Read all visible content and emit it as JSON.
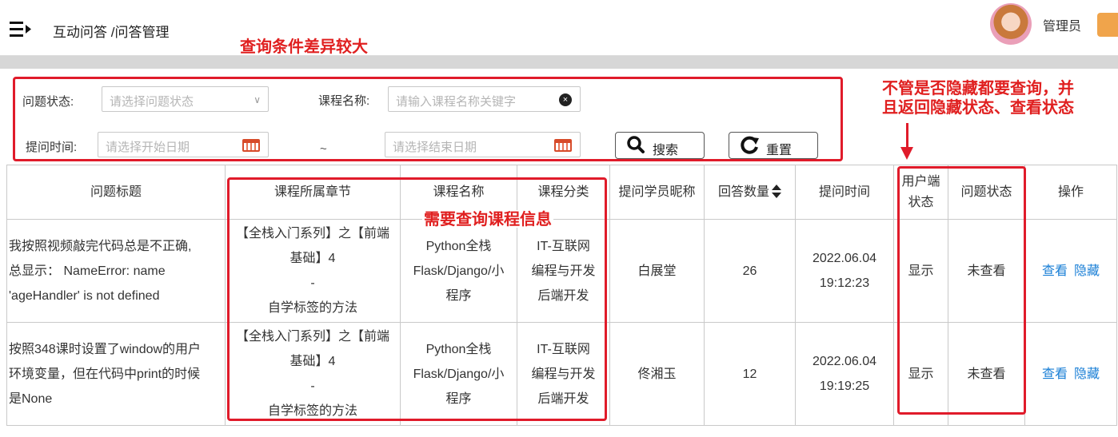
{
  "header": {
    "breadcrumb": "互动问答 /问答管理",
    "user_name": "管理员",
    "menu_icon": "menu-collapse-icon",
    "logout_icon": "logout-icon"
  },
  "annotations": {
    "filter_note": "查询条件差异较大",
    "course_note": "需要查询课程信息",
    "status_note_line1": "不管是否隐藏都要查询，并",
    "status_note_line2": "且返回隐藏状态、查看状态",
    "color": "#e01b2a"
  },
  "filters": {
    "status_label": "问题状态:",
    "status_placeholder": "请选择问题状态",
    "course_label": "课程名称:",
    "course_placeholder": "请输入课程名称关键字",
    "time_label": "提问时间:",
    "start_placeholder": "请选择开始日期",
    "range_sep": "~",
    "end_placeholder": "请选择结束日期",
    "search_label": "搜索",
    "reset_label": "重置"
  },
  "table": {
    "headers": {
      "title": "问题标题",
      "chapter": "课程所属章节",
      "course": "课程名称",
      "category": "课程分类",
      "student": "提问学员昵称",
      "answers": "回答数量",
      "time": "提问时间",
      "user_status_1": "用户端",
      "user_status_2": "状态",
      "question_status": "问题状态",
      "actions": "操作"
    },
    "rows": [
      {
        "title_1": "我按照视频敲完代码总是不正确,",
        "title_2": "总显示： NameError: name",
        "title_3": "'ageHandler' is not defined",
        "chapter_1": "【全栈入门系列】之【前端",
        "chapter_2": "基础】4",
        "chapter_3": "-",
        "chapter_4": "自学标签的方法",
        "course_1": "Python全栈",
        "course_2": "Flask/Django/小",
        "course_3": "程序",
        "category_1": "IT-互联网",
        "category_2": "编程与开发",
        "category_3": "后端开发",
        "student": "白展堂",
        "answers": "26",
        "date": "2022.06.04",
        "clock": "19:12:23",
        "user_status": "显示",
        "question_status": "未查看",
        "view": "查看",
        "hide": "隐藏"
      },
      {
        "title_1": "按照348课时设置了window的用户",
        "title_2": "环境变量，但在代码中print的时候",
        "title_3": "是None",
        "chapter_1": "【全栈入门系列】之【前端",
        "chapter_2": "基础】4",
        "chapter_3": "-",
        "chapter_4": "自学标签的方法",
        "course_1": "Python全栈",
        "course_2": "Flask/Django/小",
        "course_3": "程序",
        "category_1": "IT-互联网",
        "category_2": "编程与开发",
        "category_3": "后端开发",
        "student": "佟湘玉",
        "answers": "12",
        "date": "2022.06.04",
        "clock": "19:19:25",
        "user_status": "显示",
        "question_status": "未查看",
        "view": "查看",
        "hide": "隐藏"
      }
    ]
  }
}
